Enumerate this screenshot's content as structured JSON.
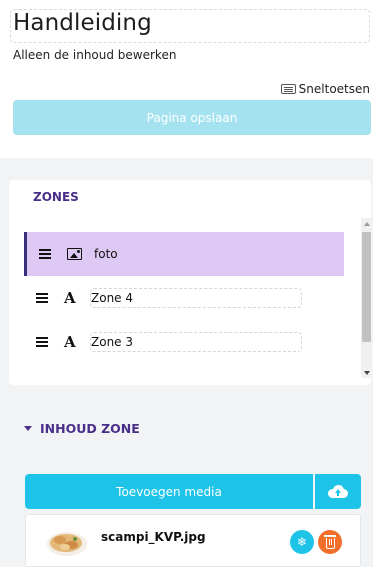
{
  "header": {
    "title": "Handleiding",
    "subtitle": "Alleen de inhoud bewerken",
    "shortcuts_label": "Sneltoetsen",
    "shortcuts_icon": "keyboard-icon",
    "save_label": "Pagina opslaan"
  },
  "zones": {
    "heading": "ZONES",
    "items": [
      {
        "label": "foto",
        "icon": "image-icon",
        "active": true
      },
      {
        "label": "Zone 4",
        "icon": "text-icon",
        "active": false
      },
      {
        "label": "Zone 3",
        "icon": "text-icon",
        "active": false
      }
    ]
  },
  "content_zone": {
    "heading": "INHOUD ZONE",
    "add_media_label": "Toevoegen media",
    "upload_icon": "cloud-upload-icon",
    "media": [
      {
        "file_name": "scampi_KVP.jpg",
        "settings_icon": "snowflake-icon",
        "delete_icon": "trash-icon"
      }
    ]
  },
  "colors": {
    "accent_cyan": "#1ec3e8",
    "save_disabled": "#a4e2f0",
    "active_zone": "#ddc9f3",
    "heading_purple": "#4a2f8a",
    "delete_orange": "#f26f2a"
  }
}
